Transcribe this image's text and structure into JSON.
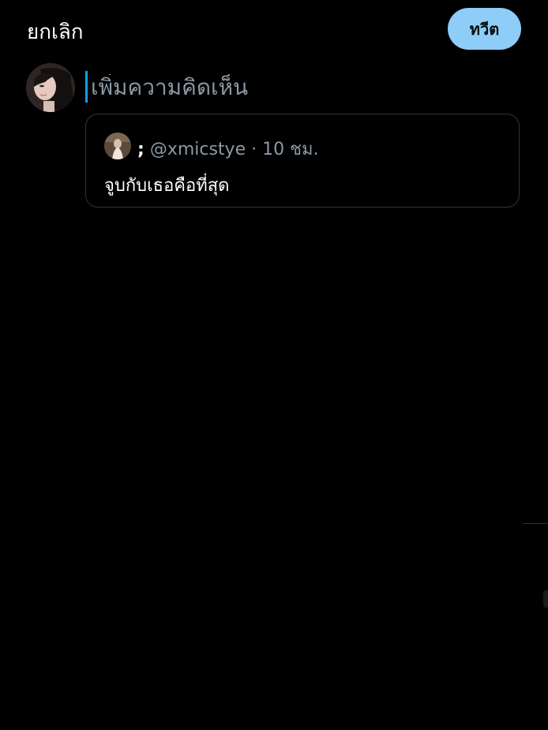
{
  "header": {
    "cancel_label": "ยกเลิก",
    "tweet_label": "ทวีต"
  },
  "composer": {
    "placeholder": "เพิ่มความคิดเห็น",
    "value": ""
  },
  "quoted_tweet": {
    "display_name": ";",
    "handle": "@xmicstye",
    "separator": "·",
    "time": "10 ชม.",
    "text": "จูบกับเธอคือที่สุด"
  },
  "colors": {
    "background": "#000000",
    "accent_button": "#8ecdf8",
    "caret": "#1d9bf0",
    "secondary_text": "#8b98a5",
    "card_border": "#2f3336"
  }
}
